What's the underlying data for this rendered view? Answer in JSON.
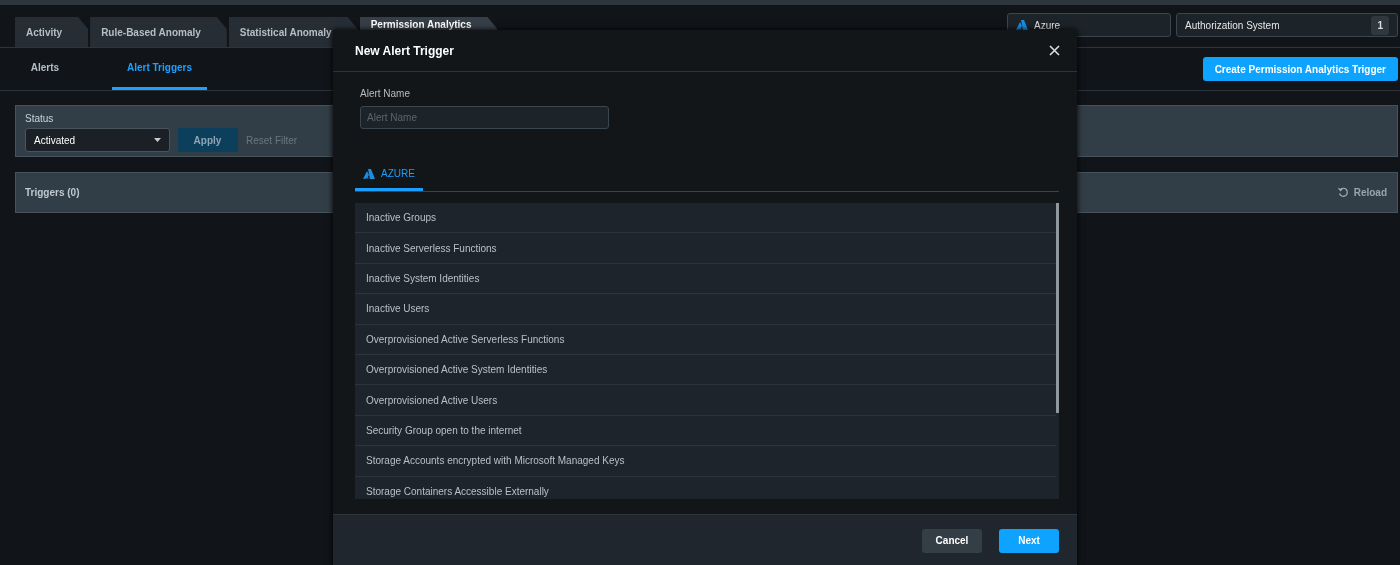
{
  "top_tabs": [
    {
      "label": "Activity",
      "selected": false
    },
    {
      "label": "Rule-Based Anomaly",
      "selected": false
    },
    {
      "label": "Statistical Anomaly",
      "selected": false
    },
    {
      "label": "Permission Analytics",
      "selected": true
    }
  ],
  "cloud_selector": {
    "label": "Azure"
  },
  "authorization_system": {
    "label": "Authorization System",
    "count": "1"
  },
  "sub_tabs": [
    {
      "label": "Alerts",
      "selected": false
    },
    {
      "label": "Alert Triggers",
      "selected": true
    }
  ],
  "create_button": "Create Permission Analytics Trigger",
  "filter": {
    "label": "Status",
    "value": "Activated",
    "apply": "Apply",
    "reset": "Reset Filter"
  },
  "triggers": {
    "title": "Triggers (0)",
    "reload": "Reload"
  },
  "modal": {
    "title": "New Alert Trigger",
    "field_label": "Alert Name",
    "placeholder": "Alert Name",
    "tabs": [
      {
        "label": "AZURE",
        "selected": true
      }
    ],
    "items": [
      "Inactive Groups",
      "Inactive Serverless Functions",
      "Inactive System Identities",
      "Inactive Users",
      "Overprovisioned Active Serverless Functions",
      "Overprovisioned Active System Identities",
      "Overprovisioned Active Users",
      "Security Group open to the internet",
      "Storage Accounts encrypted with Microsoft Managed Keys",
      "Storage Containers Accessible Externally"
    ],
    "cancel": "Cancel",
    "next": "Next"
  }
}
